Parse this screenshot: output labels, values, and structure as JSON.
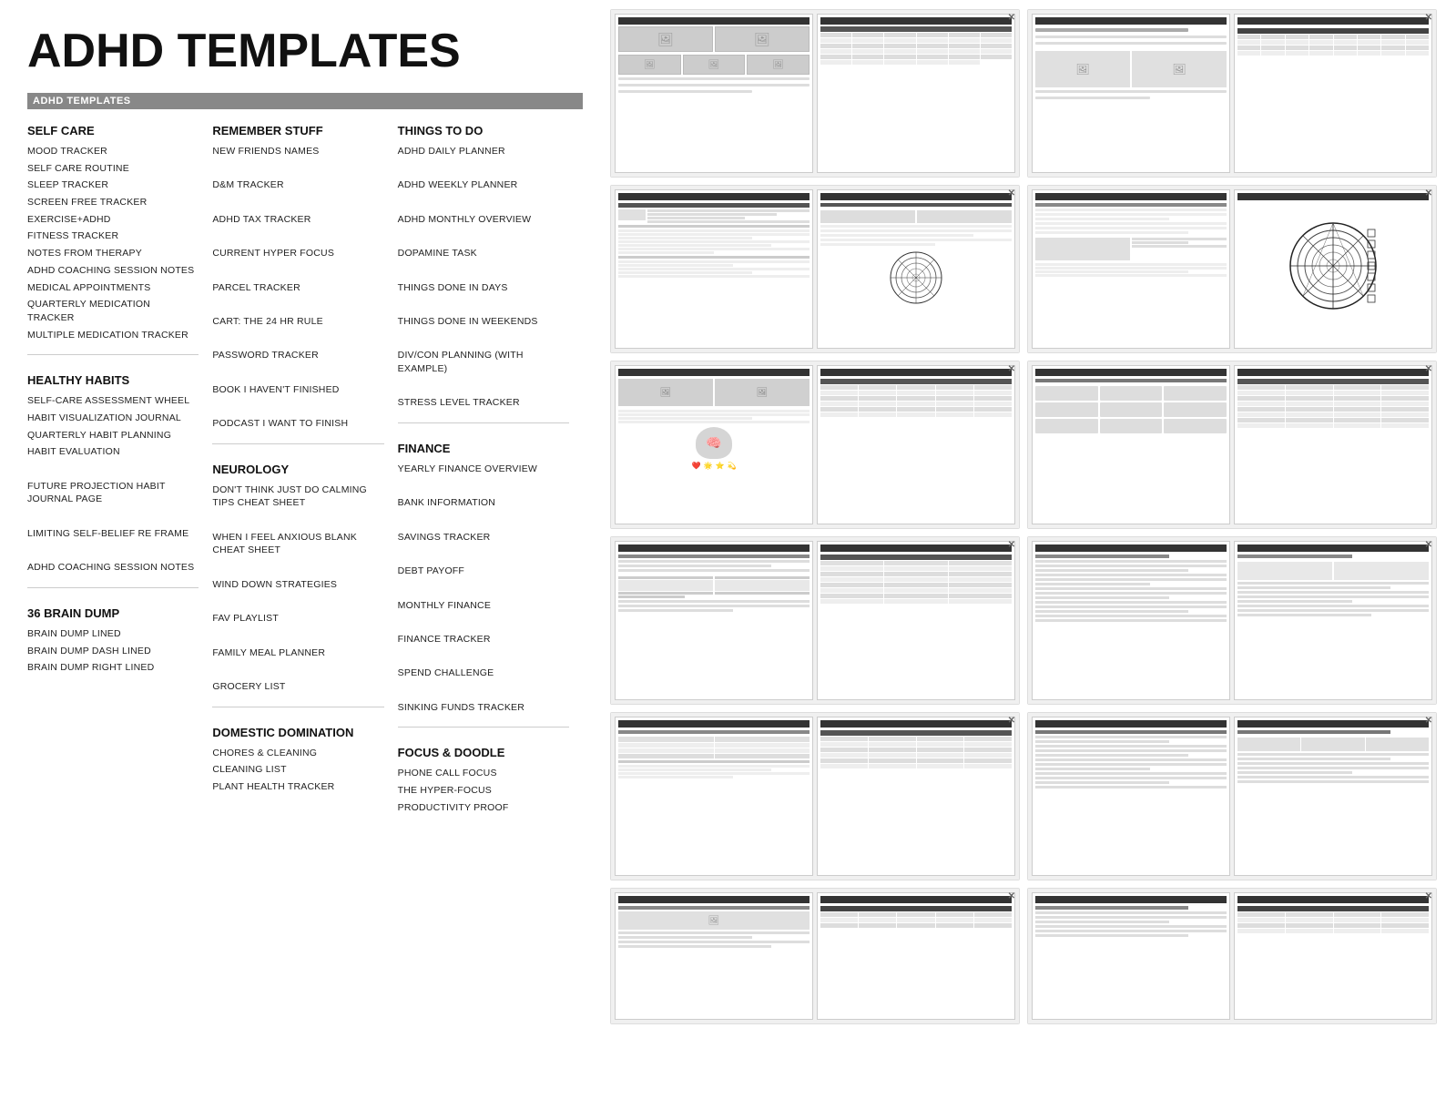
{
  "page": {
    "title": "ADHD TEMPLATES",
    "section_bar": "ADHD TEMPLATES"
  },
  "left_content": {
    "column1": {
      "categories": [
        {
          "title": "SELF CARE",
          "items": [
            "MOOD TRACKER",
            "SELF CARE  ROUTINE",
            "SLEEP TRACKER",
            "SCREEN  FREE TRACKER",
            "EXERCISE+ADHD",
            "FITNESS TRACKER",
            "NOTES FROM THERAPY",
            "ADHD COACHING SESSION NOTES",
            "MEDICAL APPOINTMENTS",
            "QUARTERLY MEDICATION TRACKER",
            "MULTIPLE MEDICATION  TRACKER"
          ]
        },
        {
          "title": "HEALTHY HABITS",
          "items": [
            "SELF-CARE  ASSESSMENT WHEEL",
            "HABIT VISUALIZATION JOURNAL",
            "QUARTERLY HABIT PLANNING",
            "HABIT EVALUATION",
            "",
            "FUTURE PROJECTION HABIT JOURNAL PAGE",
            "",
            "LIMITING SELF-BELIEF RE FRAME",
            "",
            "ADHD COACHING SESSION NOTES"
          ]
        },
        {
          "title": "36 BRAIN DUMP",
          "items": [
            "BRAIN DUMP LINED",
            "BRAIN DUMP DASH LINED",
            "BRAIN DUMP RIGHT LINED"
          ]
        }
      ]
    },
    "column2": {
      "categories": [
        {
          "title": "REMEMBER STUFF",
          "items": [
            "NEW FRIENDS NAMES",
            "",
            "D&M TRACKER",
            "",
            "ADHD TAX TRACKER",
            "",
            "CURRENT HYPER FOCUS",
            "",
            "PARCEL TRACKER",
            "",
            "CART: THE 24 HR RULE",
            "",
            "PASSWORD TRACKER",
            "",
            "BOOK I HAVEN'T  FINISHED",
            "",
            "PODCAST I WANT TO FINISH"
          ]
        },
        {
          "title": "NEUROLOGY",
          "items": [
            "DON'T THINK JUST DO CALMING TIPS CHEAT SHEET",
            "",
            "WHEN I FEEL ANXIOUS BLANK CHEAT SHEET",
            "",
            "WIND DOWN STRATEGIES",
            "",
            "FAV PLAYLIST",
            "",
            "FAMILY MEAL PLANNER",
            "",
            "GROCERY LIST"
          ]
        },
        {
          "title": "DOMESTIC DOMINATION",
          "items": [
            "CHORES & CLEANING",
            "CLEANING LIST",
            "PLANT HEALTH TRACKER"
          ]
        }
      ]
    },
    "column3": {
      "categories": [
        {
          "title": "THINGS TO DO",
          "items": [
            "ADHD DAILY PLANNER",
            "",
            "ADHD WEEKLY PLANNER",
            "",
            "ADHD MONTHLY OVERVIEW",
            "",
            "DOPAMINE TASK",
            "",
            "THINGS DONE IN DAYS",
            "",
            "THINGS DONE IN WEEKENDS",
            "",
            "DIV/CON PLANNING (WITH EXAMPLE)",
            "",
            "STRESS LEVEL TRACKER"
          ]
        },
        {
          "title": "FINANCE",
          "items": [
            "YEARLY FINANCE OVERVIEW",
            "",
            "BANK INFORMATION",
            "",
            "SAVINGS TRACKER",
            "",
            "DEBT PAYOFF",
            "",
            "MONTHLY FINANCE",
            "",
            "FINANCE TRACKER",
            "",
            "SPEND CHALLENGE",
            "",
            "SINKING FUNDS TRACKER"
          ]
        },
        {
          "title": "FOCUS & DOODLE",
          "items": [
            "PHONE CALL FOCUS",
            "THE HYPER-FOCUS",
            "PRODUCTIVITY PROOF"
          ]
        }
      ]
    }
  }
}
